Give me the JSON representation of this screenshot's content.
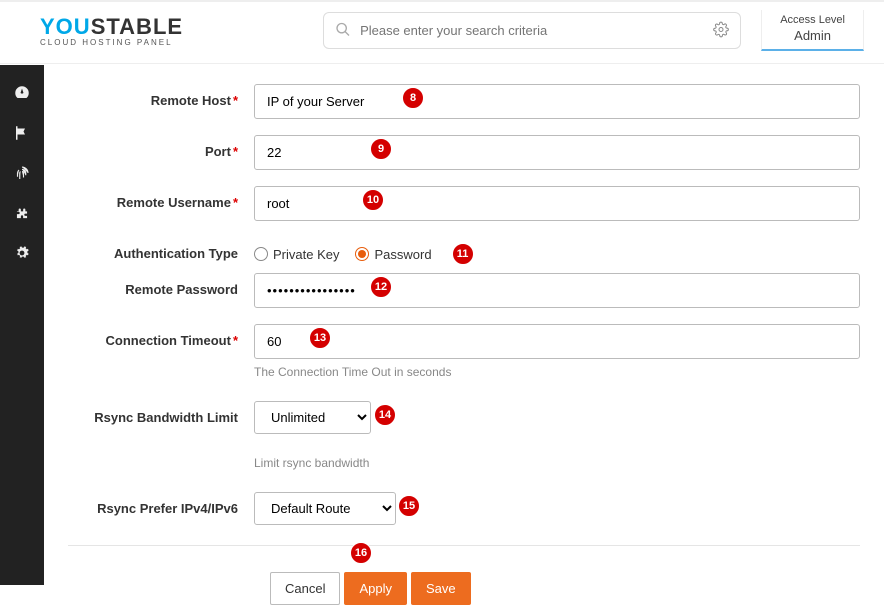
{
  "brand": {
    "part1": "YOU",
    "part2": "STABLE",
    "tagline": "CLOUD HOSTING PANEL"
  },
  "search": {
    "placeholder": "Please enter your search criteria"
  },
  "access": {
    "label": "Access Level",
    "value": "Admin"
  },
  "form": {
    "remote_host": {
      "label": "Remote Host",
      "value": "IP of your Server",
      "required": true
    },
    "port": {
      "label": "Port",
      "value": "22",
      "required": true
    },
    "remote_username": {
      "label": "Remote Username",
      "value": "root",
      "required": true
    },
    "auth_type": {
      "label": "Authentication Type",
      "option1": "Private Key",
      "option2": "Password",
      "selected": "Password"
    },
    "remote_password": {
      "label": "Remote Password",
      "value": "••••••••••••••••"
    },
    "connection_timeout": {
      "label": "Connection Timeout",
      "value": "60",
      "helper": "The Connection Time Out in seconds",
      "required": true
    },
    "rsync_bw": {
      "label": "Rsync Bandwidth Limit",
      "value": "Unlimited",
      "helper": "Limit rsync bandwidth"
    },
    "rsync_ip": {
      "label": "Rsync Prefer IPv4/IPv6",
      "value": "Default Route"
    }
  },
  "buttons": {
    "cancel": "Cancel",
    "apply": "Apply",
    "save": "Save"
  },
  "markers": {
    "m8": "8",
    "m9": "9",
    "m10": "10",
    "m11": "11",
    "m12": "12",
    "m13": "13",
    "m14": "14",
    "m15": "15",
    "m16": "16"
  }
}
